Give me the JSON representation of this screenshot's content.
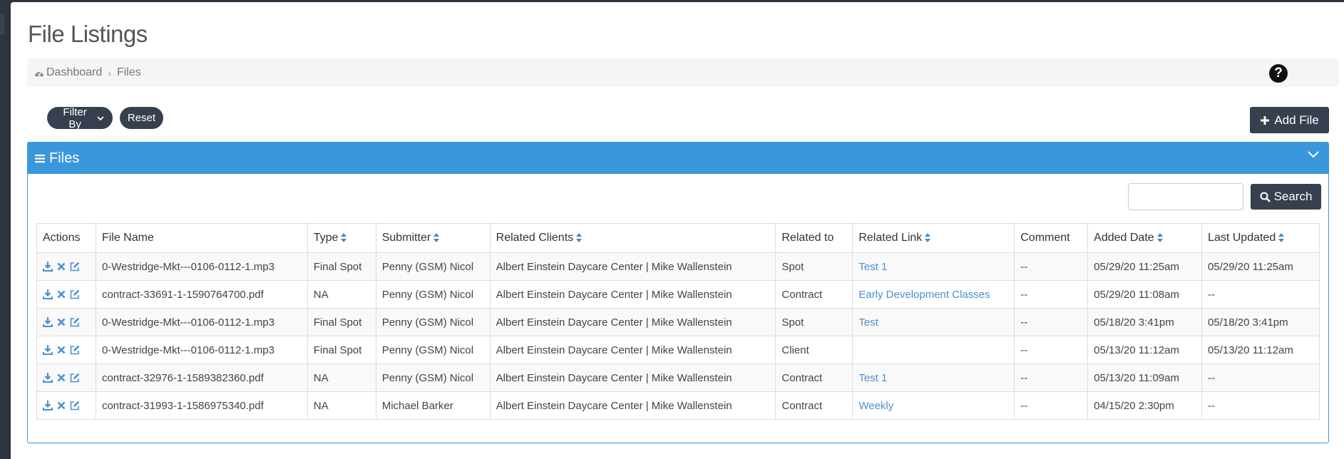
{
  "page": {
    "title": "File Listings"
  },
  "breadcrumb": {
    "home": "Dashboard",
    "current": "Files"
  },
  "toolbar": {
    "filter_label": "Filter By",
    "reset_label": "Reset",
    "add_label": "Add File"
  },
  "panel": {
    "title": "Files"
  },
  "search": {
    "value": "",
    "placeholder": "",
    "button_label": "Search"
  },
  "table": {
    "columns": [
      "Actions",
      "File Name",
      "Type",
      "Submitter",
      "Related Clients",
      "Related to",
      "Related Link",
      "Comment",
      "Added Date",
      "Last Updated"
    ],
    "rows": [
      {
        "file_name": "0-Westridge-Mkt---0106-0112-1.mp3",
        "type": "Final Spot",
        "submitter": "Penny (GSM) Nicol",
        "related_clients": "Albert Einstein Daycare Center | Mike Wallenstein",
        "related_to": "Spot",
        "related_link": "Test 1",
        "comment": "--",
        "added_date": "05/29/20 11:25am",
        "last_updated": "05/29/20 11:25am"
      },
      {
        "file_name": "contract-33691-1-1590764700.pdf",
        "type": "NA",
        "submitter": "Penny (GSM) Nicol",
        "related_clients": "Albert Einstein Daycare Center | Mike Wallenstein",
        "related_to": "Contract",
        "related_link": "Early Development Classes",
        "comment": "--",
        "added_date": "05/29/20 11:08am",
        "last_updated": "--"
      },
      {
        "file_name": "0-Westridge-Mkt---0106-0112-1.mp3",
        "type": "Final Spot",
        "submitter": "Penny (GSM) Nicol",
        "related_clients": "Albert Einstein Daycare Center | Mike Wallenstein",
        "related_to": "Spot",
        "related_link": "Test",
        "comment": "--",
        "added_date": "05/18/20 3:41pm",
        "last_updated": "05/18/20 3:41pm"
      },
      {
        "file_name": "0-Westridge-Mkt---0106-0112-1.mp3",
        "type": "Final Spot",
        "submitter": "Penny (GSM) Nicol",
        "related_clients": "Albert Einstein Daycare Center | Mike Wallenstein",
        "related_to": "Client",
        "related_link": "",
        "comment": "--",
        "added_date": "05/13/20 11:12am",
        "last_updated": "05/13/20 11:12am"
      },
      {
        "file_name": "contract-32976-1-1589382360.pdf",
        "type": "NA",
        "submitter": "Penny (GSM) Nicol",
        "related_clients": "Albert Einstein Daycare Center | Mike Wallenstein",
        "related_to": "Contract",
        "related_link": "Test 1",
        "comment": "--",
        "added_date": "05/13/20 11:09am",
        "last_updated": "--"
      },
      {
        "file_name": "contract-31993-1-1586975340.pdf",
        "type": "NA",
        "submitter": "Michael Barker",
        "related_clients": "Albert Einstein Daycare Center | Mike Wallenstein",
        "related_to": "Contract",
        "related_link": "Weekly",
        "comment": "--",
        "added_date": "04/15/20 2:30pm",
        "last_updated": "--"
      }
    ]
  },
  "colors": {
    "accent": "#3a97dc",
    "dark_button": "#36404e",
    "link": "#4b8fd1",
    "sidebar": "#2d3340"
  },
  "icons": {
    "breadcrumb_home": "dashboard-icon",
    "help": "question-circle-icon",
    "filter": "chevron-down-icon",
    "add": "plus-icon",
    "panel": "list-icon",
    "collapse": "chevron-down-icon",
    "search": "search-icon",
    "sort": "sort-icon",
    "row_actions": [
      "download-icon",
      "delete-icon",
      "edit-icon"
    ]
  }
}
